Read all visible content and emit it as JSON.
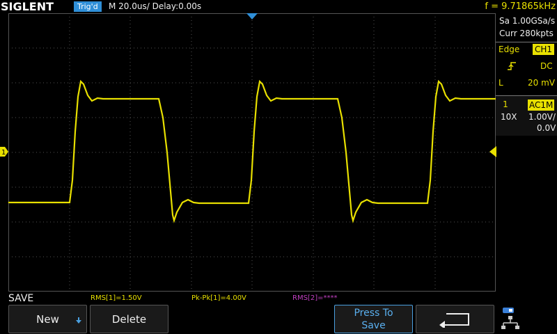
{
  "header": {
    "brand": "SIGLENT",
    "trigger_status": "Trig'd",
    "timebase": "M 20.0us/  Delay:0.00s",
    "frequency": "f = 9.71865kHz"
  },
  "acquisition": {
    "sample_rate": "Sa 1.00GSa/s",
    "memory": "Curr 280kpts"
  },
  "trigger": {
    "type": "Edge",
    "source": "CH1",
    "slope_icon": "rising-edge-icon",
    "coupling": "DC",
    "level_label": "L",
    "level_value": "20 mV"
  },
  "channel": {
    "number": "1",
    "coupling": "AC1M",
    "probe": "10X",
    "scale": "1.00V/",
    "offset": "0.0V"
  },
  "markers": {
    "ch1_marker": "1"
  },
  "measurements": [
    {
      "text": "RMS[1]=1.50V"
    },
    {
      "text": "Pk-Pk[1]=4.00V"
    },
    {
      "text": "RMS[2]=****"
    }
  ],
  "menu": {
    "title": "SAVE",
    "buttons": {
      "new": "New",
      "delete": "Delete",
      "press_line1": "Press To",
      "press_line2": "Save"
    }
  },
  "colors": {
    "channel1": "#e8e000",
    "channel2": "#c040c0",
    "accent": "#2f8fd8"
  }
}
